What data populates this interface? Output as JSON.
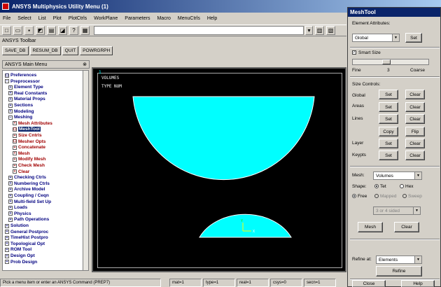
{
  "window": {
    "title": "ANSYS Multiphysics Utility Menu (1)"
  },
  "menubar": [
    "File",
    "Select",
    "List",
    "Plot",
    "PlotCtrls",
    "WorkPlane",
    "Parameters",
    "Macro",
    "MenuCtrls",
    "Help"
  ],
  "toolbar": {
    "label": "ANSYS Toolbar",
    "buttons": [
      "SAVE_DB",
      "RESUM_DB",
      "QUIT",
      "POWRGRPH"
    ]
  },
  "main_menu": {
    "title": "ANSYS Main Menu",
    "items": [
      {
        "label": "Preferences",
        "level": 1,
        "box": "☐"
      },
      {
        "label": "Preprocessor",
        "level": 1,
        "box": "−"
      },
      {
        "label": "Element Type",
        "level": 2,
        "box": "+"
      },
      {
        "label": "Real Constants",
        "level": 2,
        "box": "+"
      },
      {
        "label": "Material Props",
        "level": 2,
        "box": "+"
      },
      {
        "label": "Sections",
        "level": 2,
        "box": "+"
      },
      {
        "label": "Modeling",
        "level": 2,
        "box": "+"
      },
      {
        "label": "Meshing",
        "level": 2,
        "box": "−"
      },
      {
        "label": "Mesh Attributes",
        "level": 3,
        "box": "+"
      },
      {
        "label": "MeshTool",
        "level": 3,
        "box": "☐",
        "selected": true
      },
      {
        "label": "Size Cntrls",
        "level": 3,
        "box": "+"
      },
      {
        "label": "Mesher Opts",
        "level": 3,
        "box": "☐"
      },
      {
        "label": "Concatenate",
        "level": 3,
        "box": "+"
      },
      {
        "label": "Mesh",
        "level": 3,
        "box": "+"
      },
      {
        "label": "Modify Mesh",
        "level": 3,
        "box": "+"
      },
      {
        "label": "Check Mesh",
        "level": 3,
        "box": "+"
      },
      {
        "label": "Clear",
        "level": 3,
        "box": "+"
      },
      {
        "label": "Checking Ctrls",
        "level": 2,
        "box": "+"
      },
      {
        "label": "Numbering Ctrls",
        "level": 2,
        "box": "+"
      },
      {
        "label": "Archive Model",
        "level": 2,
        "box": "+"
      },
      {
        "label": "Coupling / Ceqn",
        "level": 2,
        "box": "+"
      },
      {
        "label": "Multi-field Set Up",
        "level": 2,
        "box": "+"
      },
      {
        "label": "Loads",
        "level": 2,
        "box": "+"
      },
      {
        "label": "Physics",
        "level": 2,
        "box": "+"
      },
      {
        "label": "Path Operations",
        "level": 2,
        "box": "+"
      },
      {
        "label": "Solution",
        "level": 1,
        "box": "+"
      },
      {
        "label": "General Postproc",
        "level": 1,
        "box": "+"
      },
      {
        "label": "TimeHist Postpro",
        "level": 1,
        "box": "+"
      },
      {
        "label": "Topological Opt",
        "level": 1,
        "box": "+"
      },
      {
        "label": "ROM Tool",
        "level": 1,
        "box": "+"
      },
      {
        "label": "Design Opt",
        "level": 1,
        "box": "+"
      },
      {
        "label": "Prob Design",
        "level": 1,
        "box": "+"
      }
    ]
  },
  "graphics": {
    "window_no": "1",
    "line1": "VOLUMES",
    "line2": "TYPE NUM",
    "shape_color": "#00ffff"
  },
  "status": {
    "prompt": "Pick a menu item or enter an ANSYS Command (PREP7)",
    "fields": [
      "mat=1",
      "type=1",
      "real=1",
      "csys=0",
      "secn=1"
    ]
  },
  "meshtool": {
    "title": "MeshTool",
    "elem_attr_label": "Element Attributes:",
    "elem_attr_value": "Global",
    "set": "Set",
    "smart_size_label": "Smart Size",
    "fine": "Fine",
    "size_value": "3",
    "coarse": "Coarse",
    "size_controls_label": "Size Controls:",
    "rows": [
      {
        "label": "Global",
        "b1": "Set",
        "b2": "Clear"
      },
      {
        "label": "Areas",
        "b1": "Set",
        "b2": "Clear"
      },
      {
        "label": "Lines",
        "b1": "Set",
        "b2": "Clear"
      },
      {
        "label": "",
        "b1": "Copy",
        "b2": "Flip"
      },
      {
        "label": "Layer",
        "b1": "Set",
        "b2": "Clear"
      },
      {
        "label": "Keypts",
        "b1": "Set",
        "b2": "Clear"
      }
    ],
    "mesh_label": "Mesh:",
    "mesh_value": "Volumes",
    "shape_label": "Shape:",
    "tet": "Tet",
    "hex": "Hex",
    "free": "Free",
    "mapped": "Mapped",
    "sweep": "Sweep",
    "sided_value": "3 or 4 sided",
    "mesh_btn": "Mesh",
    "clear_btn": "Clear",
    "refine_label": "Refine at:",
    "refine_value": "Elements",
    "refine_btn": "Refine",
    "close_btn": "Close",
    "help_btn": "Help"
  }
}
